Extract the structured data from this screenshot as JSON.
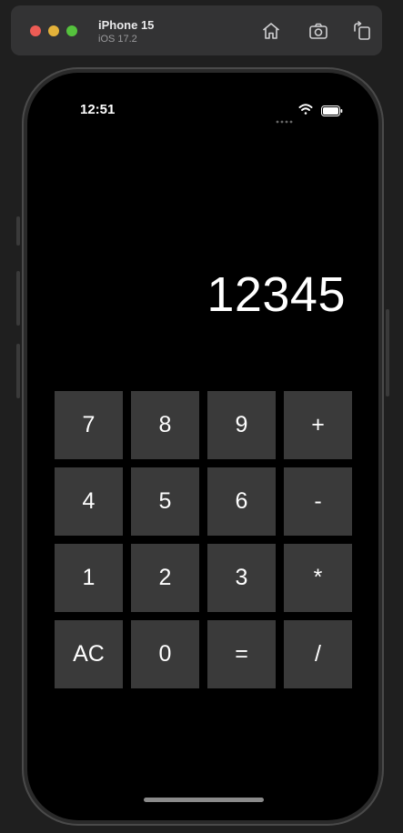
{
  "simulator": {
    "device_name": "iPhone 15",
    "os_version": "iOS 17.2",
    "icons": [
      "home-icon",
      "screenshot-icon",
      "rotate-icon"
    ],
    "traffic_light_colors": [
      "#ed5c55",
      "#e4b23a",
      "#55c23d"
    ]
  },
  "status_bar": {
    "time": "12:51",
    "icons": [
      "signal-dots-icon",
      "wifi-icon",
      "battery-icon"
    ]
  },
  "calculator": {
    "display": "12345",
    "keys": [
      {
        "label": "7",
        "name": "key-7"
      },
      {
        "label": "8",
        "name": "key-8"
      },
      {
        "label": "9",
        "name": "key-9"
      },
      {
        "label": "+",
        "name": "key-plus"
      },
      {
        "label": "4",
        "name": "key-4"
      },
      {
        "label": "5",
        "name": "key-5"
      },
      {
        "label": "6",
        "name": "key-6"
      },
      {
        "label": "-",
        "name": "key-minus"
      },
      {
        "label": "1",
        "name": "key-1"
      },
      {
        "label": "2",
        "name": "key-2"
      },
      {
        "label": "3",
        "name": "key-3"
      },
      {
        "label": "*",
        "name": "key-multiply"
      },
      {
        "label": "AC",
        "name": "key-clear"
      },
      {
        "label": "0",
        "name": "key-0"
      },
      {
        "label": "=",
        "name": "key-equals"
      },
      {
        "label": "/",
        "name": "key-divide"
      }
    ],
    "colors": {
      "key_background": "#3a3a3a",
      "key_text": "#ffffff",
      "screen_background": "#000000"
    }
  }
}
